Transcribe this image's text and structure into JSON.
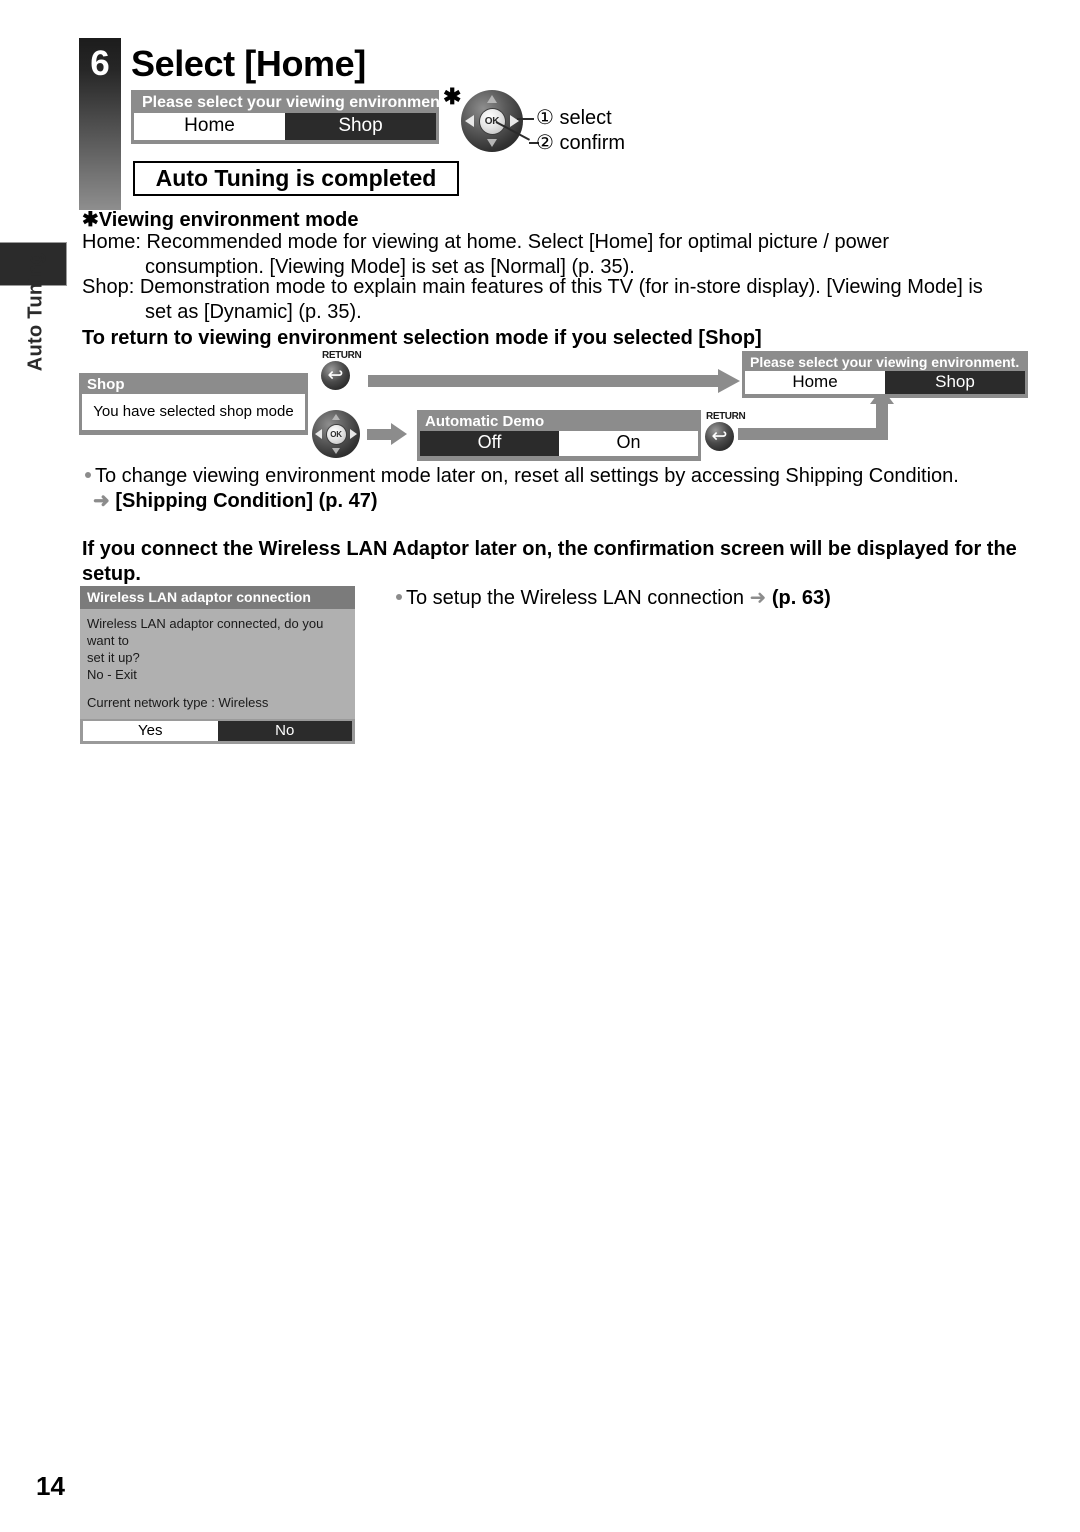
{
  "chapter": {
    "label": "Auto Tuning"
  },
  "step": {
    "number": "6",
    "title": "Select [Home]"
  },
  "env_dialog_top": {
    "title": "Please select your viewing environment.",
    "option_home": "Home",
    "option_shop": "Shop",
    "asterisk": "✱"
  },
  "remote": {
    "ok_label": "OK",
    "callout_select": "① select",
    "callout_confirm": "② confirm"
  },
  "completed_box": {
    "text": "Auto Tuning is completed"
  },
  "viewing_mode": {
    "heading": "✱Viewing environment mode",
    "home_line1": "Home: Recommended mode for viewing at home. Select [Home] for optimal picture / power",
    "home_line2": "consumption. [Viewing Mode] is set as [Normal] (p. 35).",
    "shop_line1": "Shop: Demonstration mode to explain main features of this TV (for in-store display). [Viewing Mode] is",
    "shop_line2": "set as [Dynamic] (p. 35)."
  },
  "return_section": {
    "heading": "To return to viewing environment selection mode if you selected [Shop]",
    "shop_dialog": {
      "title": "Shop",
      "body": "You have selected shop mode"
    },
    "return_label_1": "RETURN",
    "return_label_2": "RETURN",
    "return_glyph": "↩",
    "demo_dialog": {
      "title": "Automatic Demo",
      "option_off": "Off",
      "option_on": "On"
    },
    "env_dialog_bottom": {
      "title": "Please select your viewing environment.",
      "option_home": "Home",
      "option_shop": "Shop"
    }
  },
  "notes": {
    "change_mode": "To change viewing environment mode later on, reset all settings by accessing Shipping Condition.",
    "shipping_condition": "[Shipping Condition] (p. 47)",
    "arrow_glyph": "➜"
  },
  "wireless": {
    "heading": "If you connect the Wireless LAN Adaptor later on, the confirmation screen will be displayed for the setup.",
    "setup_note_text": "To setup the Wireless LAN connection",
    "setup_note_page": "(p. 63)",
    "dialog": {
      "title": "Wireless LAN adaptor connection",
      "body_line1": "Wireless LAN adaptor connected, do you want to",
      "body_line2": "set it up?",
      "body_line3": "No - Exit",
      "body_line4": "Current network type : Wireless",
      "option_yes": "Yes",
      "option_no": "No"
    }
  },
  "page_number": "14",
  "colors": {
    "osd_header_grey": "#8c8c8c",
    "osd_selected_dark": "#2b2b2b",
    "arrow_grey": "#8c8c8c",
    "chapter_dark": "#2b2b2b"
  }
}
